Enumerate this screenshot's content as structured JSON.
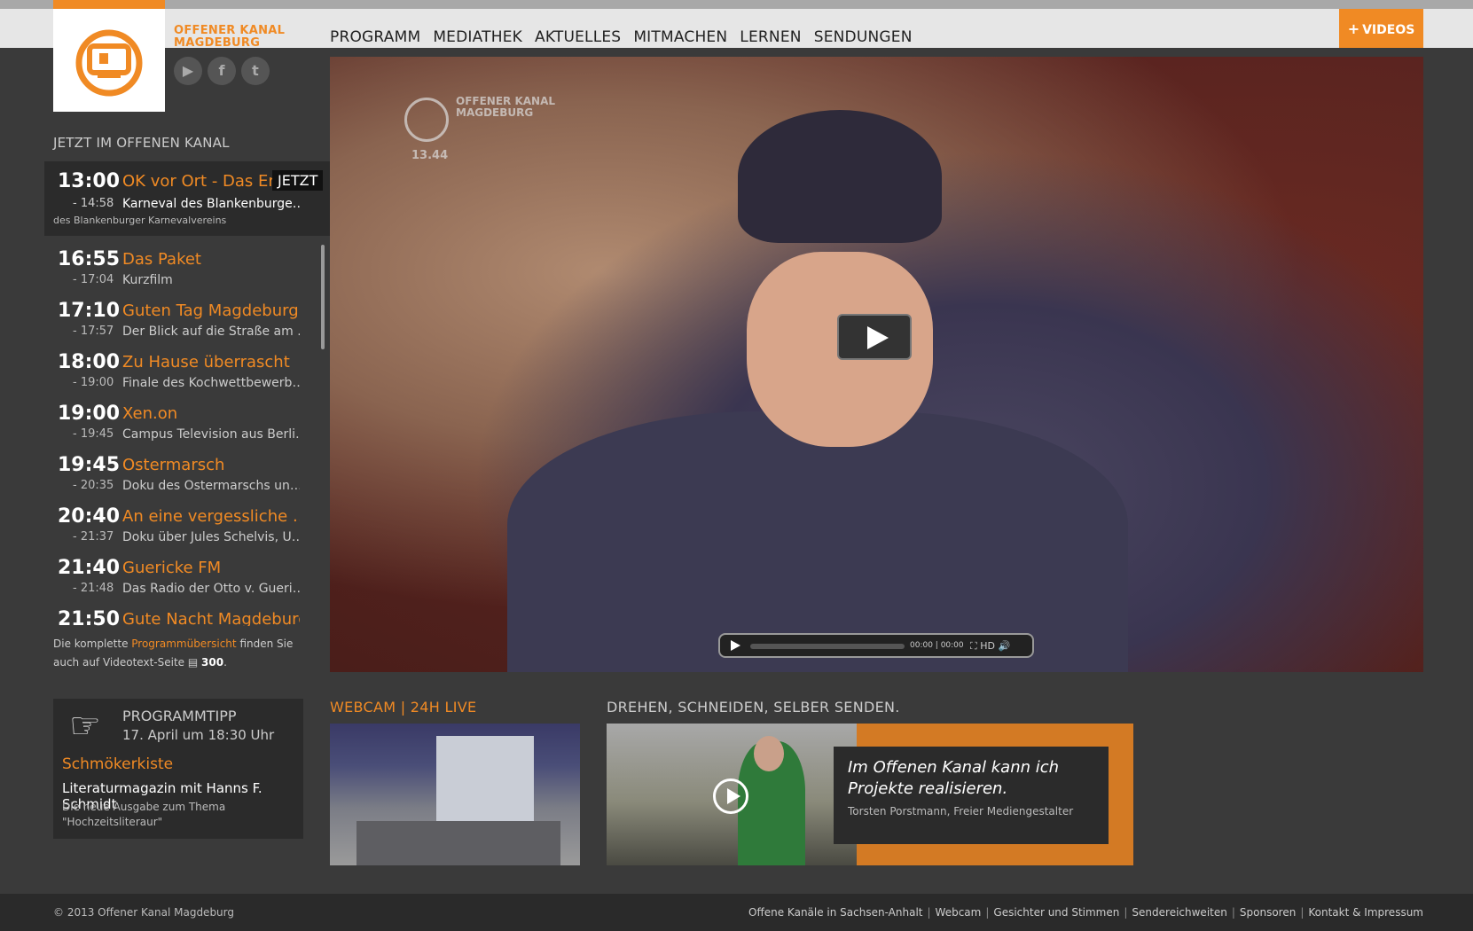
{
  "brand": {
    "line1": "OFFENER KANAL",
    "line2": "MAGDEBURG"
  },
  "nav": [
    "PROGRAMM",
    "MEDIATHEK",
    "AKTUELLES",
    "MITMACHEN",
    "LERNEN",
    "SENDUNGEN"
  ],
  "videos_button": {
    "plus": "+",
    "label": "VIDEOS"
  },
  "colors": {
    "accent": "#f08a24",
    "bg": "#3a3a3a"
  },
  "sidebar": {
    "heading": "JETZT IM OFFENEN KANAL",
    "current": {
      "start": "13:00",
      "title": "OK vor Ort - Das Er…",
      "badge": "JETZT",
      "end": "- 14:58",
      "subtitle": "Karneval des Blankenburge…",
      "description": "des Blankenburger Karnevalvereins"
    },
    "schedule": [
      {
        "start": "16:55",
        "title": "Das Paket",
        "end": "- 17:04",
        "subtitle": "Kurzfilm"
      },
      {
        "start": "17:10",
        "title": "Guten Tag Magdeburg",
        "end": "- 17:57",
        "subtitle": "Der Blick auf die Straße am …"
      },
      {
        "start": "18:00",
        "title": "Zu Hause überrascht",
        "end": "- 19:00",
        "subtitle": "Finale des Kochwettbewerb…"
      },
      {
        "start": "19:00",
        "title": "Xen.on",
        "end": "- 19:45",
        "subtitle": "Campus Television aus Berli…"
      },
      {
        "start": "19:45",
        "title": "Ostermarsch",
        "end": "- 20:35",
        "subtitle": "Doku des Ostermarschs un…"
      },
      {
        "start": "20:40",
        "title": "An eine vergessliche …",
        "end": "- 21:37",
        "subtitle": "Doku über Jules Schelvis, Ü…"
      },
      {
        "start": "21:40",
        "title": "Guericke FM",
        "end": "- 21:48",
        "subtitle": "Das Radio der Otto v. Gueri…"
      },
      {
        "start": "21:50",
        "title": "Gute Nacht Magdeburg",
        "end": "",
        "subtitle": ""
      }
    ],
    "teletext": {
      "pre": "Die komplette ",
      "link": "Programmübersicht",
      "mid": " finden Sie auch auf Videotext-Seite ",
      "page": "300",
      "post": "."
    },
    "tipp": {
      "heading": "PROGRAMMTIPP",
      "date": "17. April um 18:30 Uhr",
      "name": "Schmökerkiste",
      "subtitle": "Literaturmagazin mit Hanns F. Schmidt",
      "description": "Die neue Ausgabe zum Thema \"Hochzeitsliteraur\""
    }
  },
  "video": {
    "watermark_line1": "OFFENER KANAL",
    "watermark_line2": "MAGDEBURG",
    "watermark_time": "13.44",
    "time": "00:00 | 00:00",
    "hd": "HD"
  },
  "webcam": {
    "heading": "WEBCAM | 24H LIVE"
  },
  "diy": {
    "heading": "DREHEN, SCHNEIDEN, SELBER SENDEN.",
    "quote": "Im Offenen Kanal kann ich Projekte realisieren.",
    "author": "Torsten Porstmann, Freier Mediengestalter"
  },
  "footer": {
    "copyright": "© 2013 Offener Kanal Magdeburg",
    "links": [
      "Offene Kanäle in Sachsen-Anhalt",
      "Webcam",
      "Gesichter und Stimmen",
      "Sendereichweiten",
      "Sponsoren",
      "Kontakt & Impressum"
    ]
  }
}
